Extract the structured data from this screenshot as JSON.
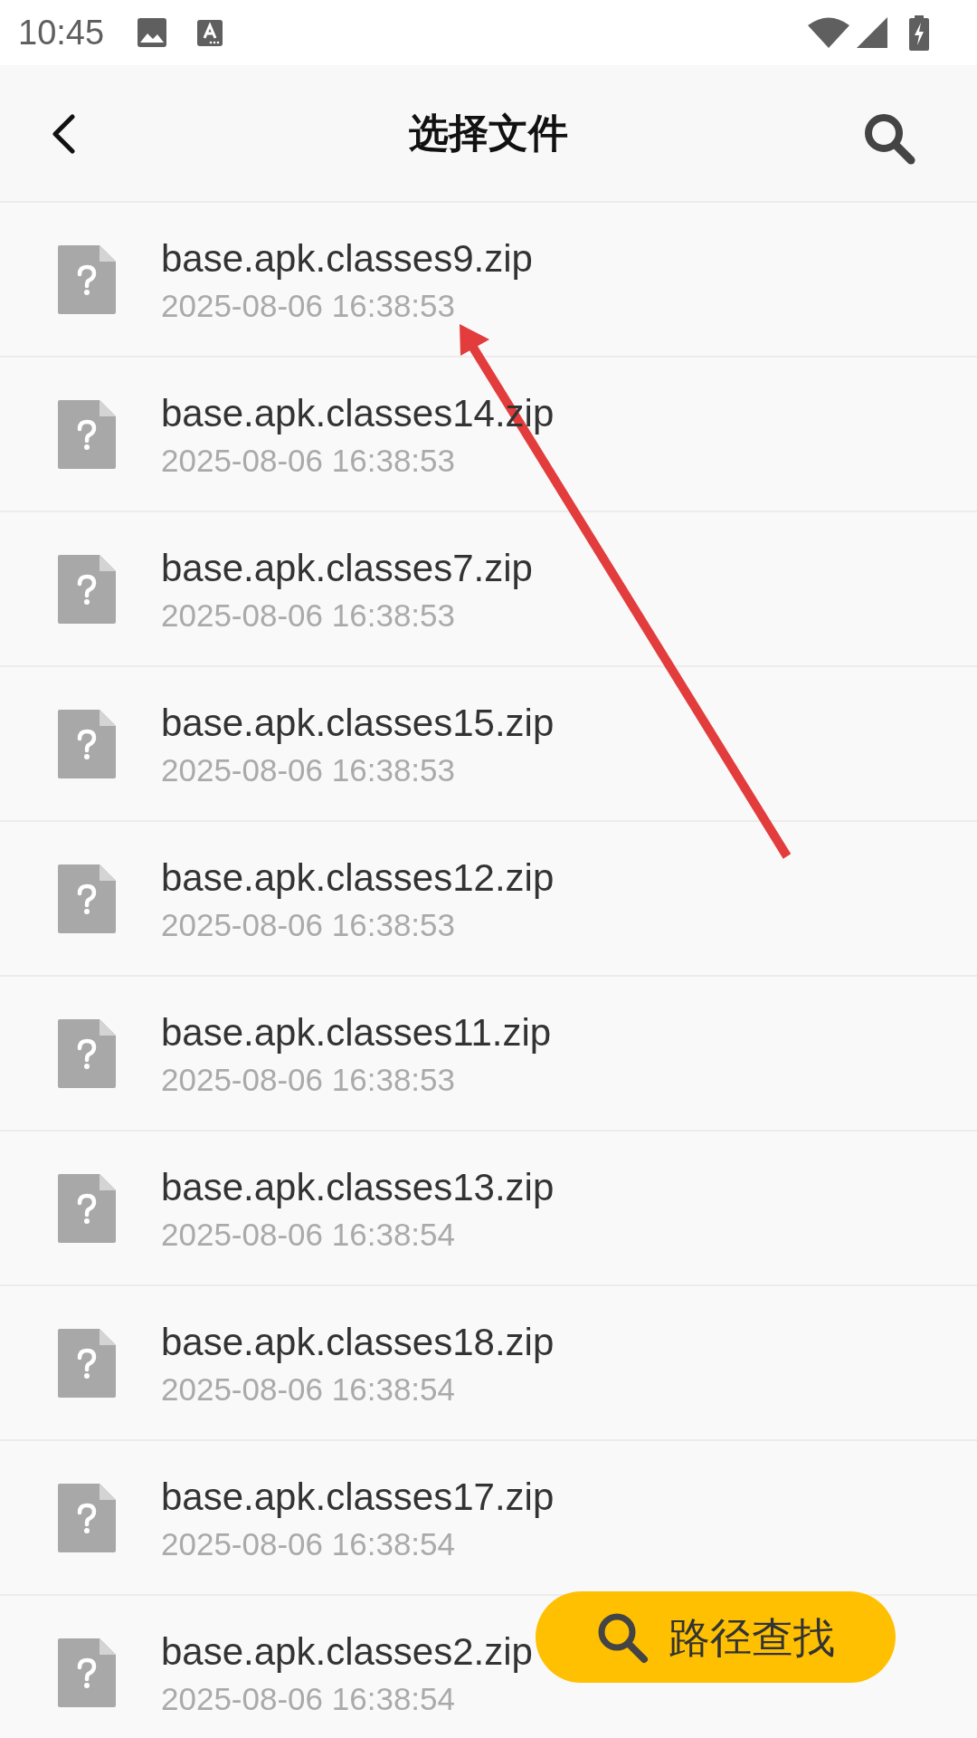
{
  "status_bar": {
    "time": "10:45"
  },
  "app_bar": {
    "title": "选择文件"
  },
  "files": [
    {
      "name": "base.apk.classes9.zip",
      "modified": "2025-08-06 16:38:53"
    },
    {
      "name": "base.apk.classes14.zip",
      "modified": "2025-08-06 16:38:53"
    },
    {
      "name": "base.apk.classes7.zip",
      "modified": "2025-08-06 16:38:53"
    },
    {
      "name": "base.apk.classes15.zip",
      "modified": "2025-08-06 16:38:53"
    },
    {
      "name": "base.apk.classes12.zip",
      "modified": "2025-08-06 16:38:53"
    },
    {
      "name": "base.apk.classes11.zip",
      "modified": "2025-08-06 16:38:53"
    },
    {
      "name": "base.apk.classes13.zip",
      "modified": "2025-08-06 16:38:54"
    },
    {
      "name": "base.apk.classes18.zip",
      "modified": "2025-08-06 16:38:54"
    },
    {
      "name": "base.apk.classes17.zip",
      "modified": "2025-08-06 16:38:54"
    },
    {
      "name": "base.apk.classes2.zip",
      "modified": "2025-08-06 16:38:54"
    }
  ],
  "fab": {
    "label": "路径查找"
  },
  "annotations": [
    {
      "kind": "arrow"
    }
  ]
}
